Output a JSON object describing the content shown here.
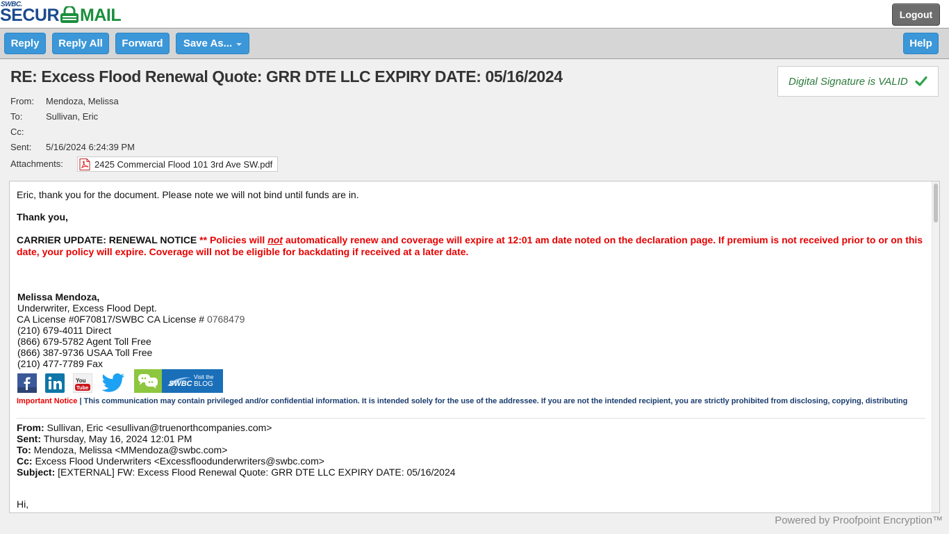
{
  "app": {
    "logo_small": "SWBC.",
    "logo_secure": "SECUR",
    "logo_mail": "MAIL",
    "logout_label": "Logout",
    "powered_by": "Powered by Proofpoint Encryption™"
  },
  "toolbar": {
    "reply": "Reply",
    "reply_all": "Reply All",
    "forward": "Forward",
    "save_as": "Save As...",
    "help": "Help"
  },
  "message": {
    "subject": "RE: Excess Flood Renewal Quote: GRR DTE LLC EXPIRY DATE: 05/16/2024",
    "signature_status": "Digital Signature is VALID",
    "from_label": "From:",
    "from": "Mendoza, Melissa",
    "to_label": "To:",
    "to": "Sullivan, Eric",
    "cc_label": "Cc:",
    "cc": "",
    "sent_label": "Sent:",
    "sent": "5/16/2024 6:24:39 PM",
    "attachments_label": "Attachments:",
    "attachment": "2425 Commercial Flood 101 3rd Ave SW.pdf"
  },
  "body": {
    "line1": "Eric, thank you for the document. Please note we will not bind until funds are in.",
    "thanks": "Thank you,",
    "notice_lead": "CARRIER UPDATE: RENEWAL NOTICE ",
    "notice_stars": "** Policies will ",
    "notice_not": "not",
    "notice_rest": " automatically renew and coverage will expire at 12:01 am date noted on the declaration page. If premium is not received prior to or on this date, your policy will expire. Coverage will not be eligible for backdating if received at a later date.",
    "sig_name": "Melissa Mendoza,",
    "sig_title": "Underwriter, Excess Flood Dept.",
    "sig_license_a": "CA License #0F70817/SWBC CA License # ",
    "sig_license_b": "0768479",
    "sig_direct": "(210) 679-4011 Direct",
    "sig_agent": "(866) 679-5782 Agent Toll Free",
    "sig_usaa": "(866) 387-9736 USAA Toll Free",
    "sig_fax": "(210) 477-7789  Fax",
    "blog_line1": "Visit the",
    "blog_line2": "BLOG",
    "blog_brand": "SWBC",
    "important_label": "Important Notice",
    "important_text": " | This communication may contain privileged and/or confidential information.  It is intended solely for the use of the addressee.  If you are not the intended recipient, you are strictly prohibited from disclosing, copying, distributing",
    "fwd_from_label": "From:",
    "fwd_from": " Sullivan, Eric <esullivan@truenorthcompanies.com>",
    "fwd_sent_label": "Sent:",
    "fwd_sent": " Thursday, May 16, 2024 12:01 PM",
    "fwd_to_label": "To:",
    "fwd_to": " Mendoza, Melissa <MMendoza@swbc.com>",
    "fwd_cc_label": "Cc:",
    "fwd_cc": " Excess Flood Underwriters <Excessfloodunderwriters@swbc.com>",
    "fwd_subject_label": "Subject:",
    "fwd_subject": " [EXTERNAL] FW: Excess Flood Renewal Quote: GRR DTE LLC EXPIRY DATE: 05/16/2024",
    "hi": "Hi,"
  },
  "colors": {
    "button_blue": "#3b97d8",
    "notice_red": "#e60000",
    "valid_green": "#2b7a3a",
    "brand_blue": "#1b4b8e"
  },
  "icons": [
    "lock-icon",
    "check-icon",
    "pdf-icon",
    "facebook-icon",
    "linkedin-icon",
    "youtube-icon",
    "twitter-icon",
    "chat-icon"
  ]
}
